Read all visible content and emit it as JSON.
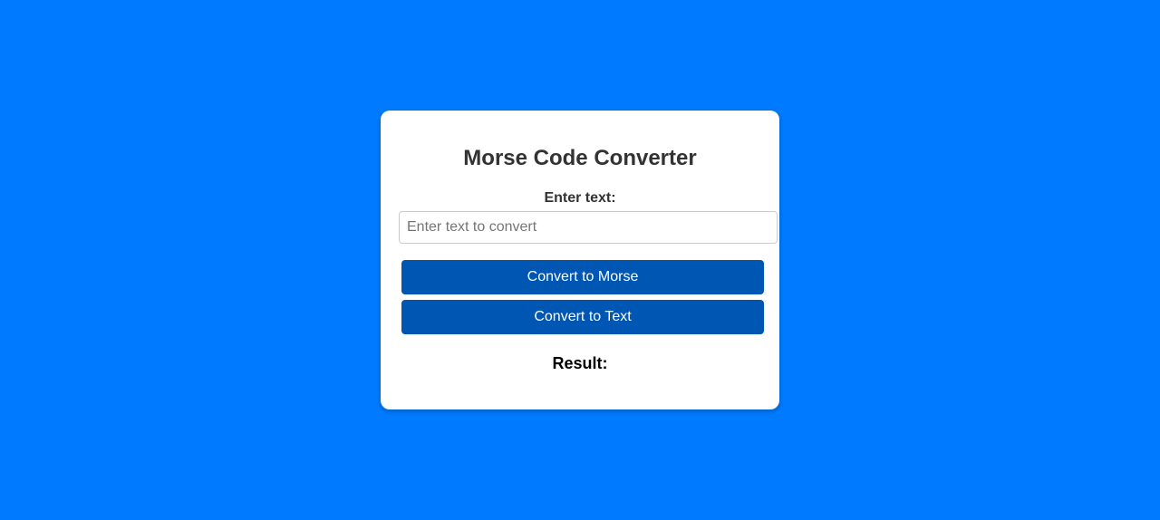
{
  "app": {
    "title": "Morse Code Converter"
  },
  "form": {
    "label": "Enter text:",
    "input_value": "",
    "input_placeholder": "Enter text to convert"
  },
  "buttons": {
    "to_morse_label": "Convert to Morse",
    "to_text_label": "Convert to Text"
  },
  "result": {
    "label": "Result:",
    "value": ""
  },
  "colors": {
    "background": "#007bff",
    "card": "#ffffff",
    "button": "#0056b3",
    "button_text": "#ffffff",
    "heading_text": "#333333"
  }
}
